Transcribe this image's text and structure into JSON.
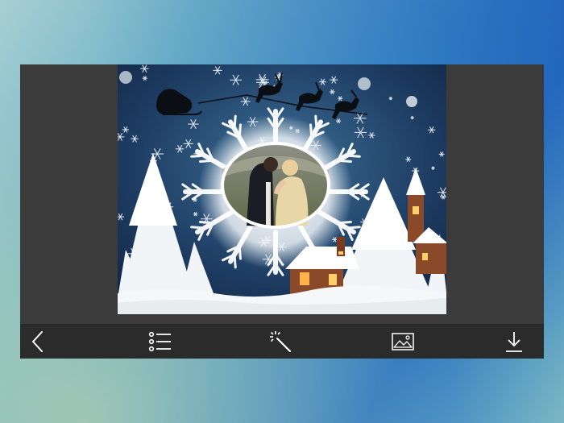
{
  "colors": {
    "toolbar_bg": "#2b2b2b",
    "canvas_bg": "#3b3b3b",
    "icon_color": "#ffffff",
    "snow_sky": "#1e3a5c"
  },
  "photo": {
    "theme": "Christmas winter frame",
    "icon": "winter-frame-image"
  },
  "toolbar": {
    "buttons": [
      {
        "icon": "back-icon"
      },
      {
        "icon": "list-icon"
      },
      {
        "icon": "magic-wand-icon"
      },
      {
        "icon": "image-icon"
      },
      {
        "icon": "download-icon"
      }
    ]
  }
}
